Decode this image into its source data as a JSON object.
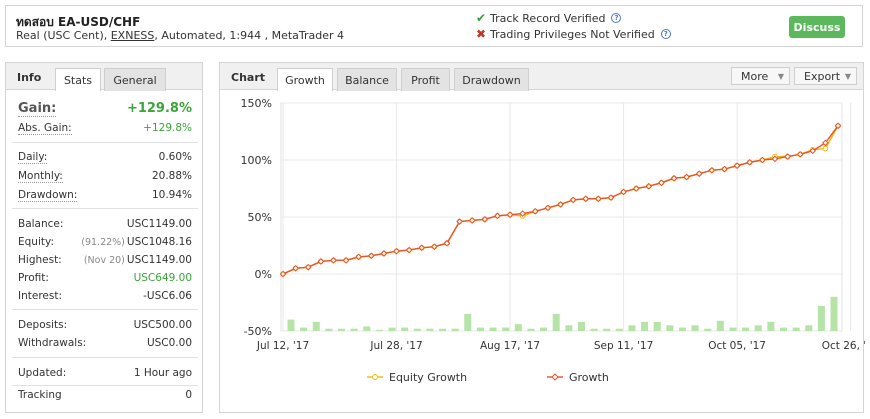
{
  "header": {
    "title": "ทดสอบ EA-USD/CHF",
    "sub_prefix": "Real (USC Cent), ",
    "broker": "EXNESS",
    "sub_suffix": ", Automated, 1:944 , MetaTrader 4",
    "track_record": "Track Record Verified",
    "trading_privileges": "Trading Privileges Not Verified",
    "discuss": "Discuss",
    "help_glyph": "?",
    "ok_glyph": "✔",
    "bad_glyph": "✖"
  },
  "left_panel": {
    "label": "Info",
    "tabs": [
      "Stats",
      "General"
    ],
    "active_tab": "Stats",
    "gain": {
      "label": "Gain:",
      "value": "+129.8%"
    },
    "abs_gain": {
      "label": "Abs. Gain:",
      "value": "+129.8%"
    },
    "daily": {
      "label": "Daily:",
      "value": "0.60%"
    },
    "monthly": {
      "label": "Monthly:",
      "value": "20.88%"
    },
    "drawdown": {
      "label": "Drawdown:",
      "value": "10.94%"
    },
    "balance": {
      "label": "Balance:",
      "value": "USC1149.00"
    },
    "equity": {
      "label": "Equity:",
      "note": "(91.22%)",
      "value": "USC1048.16"
    },
    "highest": {
      "label": "Highest:",
      "note": "(Nov 20)",
      "value": "USC1149.00"
    },
    "profit": {
      "label": "Profit:",
      "value": "USC649.00"
    },
    "interest": {
      "label": "Interest:",
      "value": "-USC6.06"
    },
    "deposits": {
      "label": "Deposits:",
      "value": "USC500.00"
    },
    "withdrawals": {
      "label": "Withdrawals:",
      "value": "USC0.00"
    },
    "updated": {
      "label": "Updated:",
      "value": "1 Hour ago"
    },
    "tracking": {
      "label": "Tracking",
      "value": "0"
    }
  },
  "chart_panel": {
    "label": "Chart",
    "tabs": [
      "Growth",
      "Balance",
      "Profit",
      "Drawdown"
    ],
    "active_tab": "Growth",
    "more_button": "More",
    "export_button": "Export",
    "caret_glyph": "▼"
  },
  "colors": {
    "growth": "#e8522a",
    "equity": "#f5b800",
    "bars": "#b5e3a8",
    "discuss": "#5cb85c",
    "positive": "#3aa53a"
  },
  "chart_data": {
    "type": "line",
    "xlabel": "",
    "ylabel": "",
    "ylim": [
      -50,
      150
    ],
    "y_ticks": [
      "150%",
      "100%",
      "50%",
      "0%",
      "-50%"
    ],
    "y_tick_values": [
      150,
      100,
      50,
      0,
      -50
    ],
    "x_tick_labels": [
      "Jul 12, '17",
      "Jul 28, '17",
      "Aug 17, '17",
      "Sep 11, '17",
      "Oct 05, '17",
      "Oct 26, '17"
    ],
    "x_tick_index": [
      0,
      9,
      18,
      27,
      36,
      45
    ],
    "grid": true,
    "legend_position": "bottom",
    "series": [
      {
        "name": "Equity Growth",
        "values": [
          0,
          5,
          6,
          11,
          12,
          12,
          15,
          16,
          18,
          20,
          21,
          23,
          24,
          27,
          46,
          47,
          48,
          51,
          52,
          51,
          55,
          58,
          61,
          65,
          66,
          66,
          67,
          72,
          75,
          77,
          80,
          84,
          85,
          88,
          91,
          92,
          95,
          98,
          100,
          103,
          103,
          105,
          109,
          110,
          130
        ]
      },
      {
        "name": "Growth",
        "values": [
          0,
          5,
          6,
          11,
          12,
          12,
          15,
          16,
          18,
          20,
          21,
          23,
          24,
          27,
          46,
          47,
          48,
          51,
          52,
          53,
          55,
          58,
          61,
          65,
          66,
          66,
          67,
          72,
          75,
          77,
          80,
          84,
          85,
          88,
          91,
          92,
          95,
          98,
          100,
          101,
          103,
          105,
          108,
          115,
          130
        ]
      }
    ],
    "bars": [
      10,
      3,
      8,
      2,
      2,
      2,
      4,
      1,
      3,
      3,
      2,
      2,
      2,
      2,
      15,
      3,
      3,
      3,
      6,
      2,
      3,
      15,
      5,
      8,
      2,
      2,
      2,
      5,
      8,
      8,
      5,
      3,
      5,
      2,
      9,
      3,
      3,
      5,
      8,
      3,
      3,
      5,
      22,
      30
    ]
  }
}
